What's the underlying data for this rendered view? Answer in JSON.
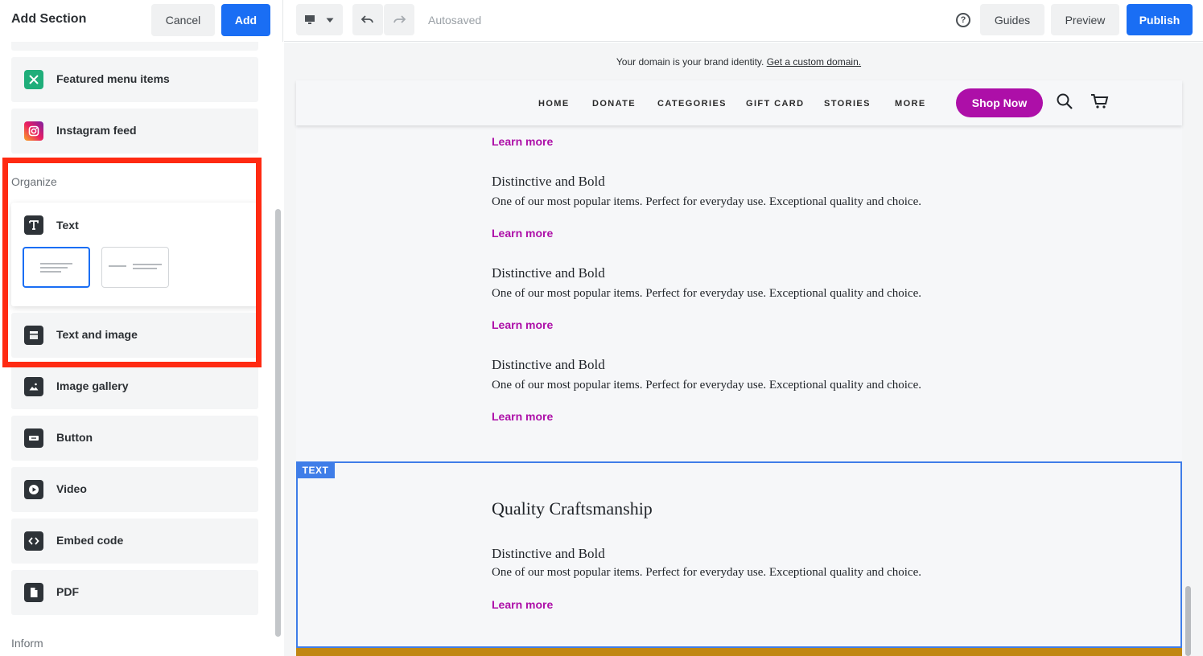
{
  "sidebar": {
    "title": "Add Section",
    "cancel_label": "Cancel",
    "add_label": "Add",
    "items_top": [
      {
        "label": "Featured menu items",
        "icon": "featured-menu-icon",
        "color": "#1fae7a"
      },
      {
        "label": "Instagram feed",
        "icon": "instagram-icon"
      }
    ],
    "organize_label": "Organize",
    "text_item": {
      "label": "Text",
      "icon": "text-icon"
    },
    "text_and_image": {
      "label": "Text and image",
      "icon": "text-image-icon"
    },
    "items_bottom": [
      {
        "label": "Image gallery",
        "icon": "image-gallery-icon"
      },
      {
        "label": "Button",
        "icon": "button-icon"
      },
      {
        "label": "Video",
        "icon": "video-icon"
      },
      {
        "label": "Embed code",
        "icon": "embed-code-icon"
      },
      {
        "label": "PDF",
        "icon": "pdf-icon"
      }
    ],
    "inform_label": "Inform",
    "highlight_color": "#ff2a12"
  },
  "toolbar": {
    "autosaved": "Autosaved",
    "guides": "Guides",
    "preview": "Preview",
    "publish": "Publish",
    "accent": "#1a6ef4"
  },
  "canvas": {
    "domain_note_text": "Your domain is your brand identity. ",
    "domain_note_link": "Get a custom domain.",
    "nav": [
      "HOME",
      "DONATE",
      "CATEGORIES",
      "GIFT CARD",
      "STORIES",
      "MORE"
    ],
    "shop_now": "Shop Now",
    "brand_color": "#ad0fa8",
    "learn_more": "Learn more",
    "item_title": "Distinctive and Bold",
    "item_desc": "One of our most popular items. Perfect for everyday use. Exceptional quality and choice.",
    "section_tag": "TEXT",
    "section_heading": "Quality Craftsmanship"
  }
}
